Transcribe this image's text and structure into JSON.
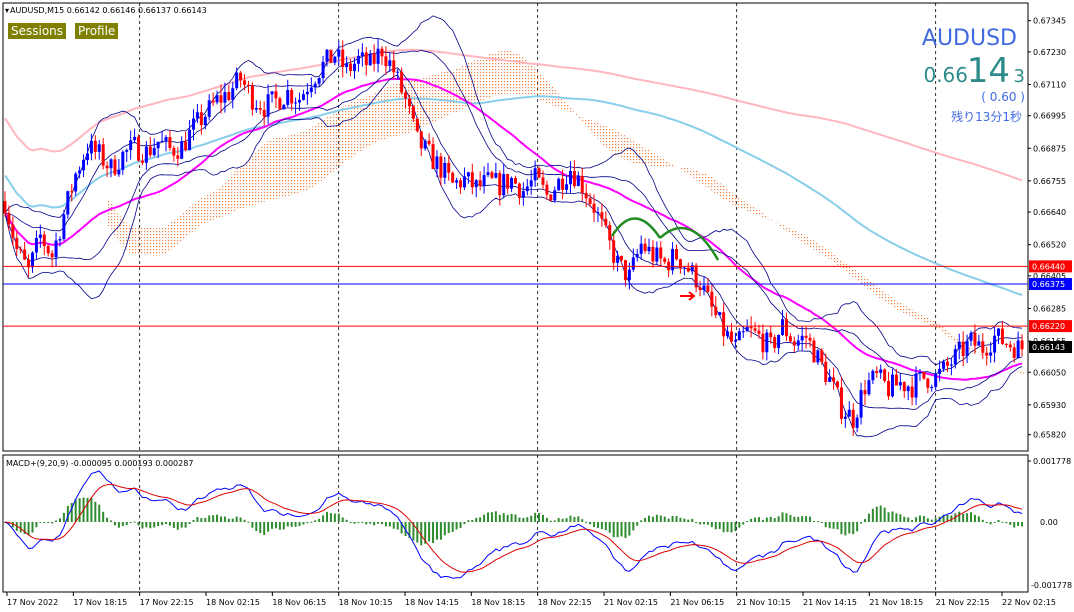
{
  "header": {
    "text": "AUDUSD,M15  0.66142 0.66146 0.66137 0.66143",
    "symbol_big": "AUDUSD"
  },
  "buttons": {
    "sessions": "Sessions",
    "profile": "Profile"
  },
  "price_panel": {
    "prefix": "0.66",
    "big": "14",
    "last": "3",
    "change": "( 0.60 )",
    "remaining": "残り13分1秒"
  },
  "macd": {
    "label": "MACD+(9,20,9) -0.000095 0.000193 0.000287",
    "top_label": "0.001778",
    "zero_label": "0.00",
    "bottom_label": "-0.001778"
  },
  "colors": {
    "up": "#0000ff",
    "down": "#ff0000",
    "ma_fast": "#ff00ff",
    "ma_mid": "#87ceeb",
    "ma_slow": "#ffb6c1",
    "cloud": "#f08040",
    "bollinger": "#00008b",
    "macd_signal": "#dd0000",
    "macd_hist": "#2e8b2e",
    "title": "#4169e1",
    "price": "#2e8b8b",
    "arc": "#228b22"
  },
  "chart_data": {
    "type": "candlestick",
    "symbol": "AUDUSD",
    "timeframe": "M15",
    "ylim": [
      0.6576,
      0.6741
    ],
    "y_ticks": [
      0.67345,
      0.6723,
      0.6711,
      0.66995,
      0.66875,
      0.66755,
      0.6664,
      0.6652,
      0.66405,
      0.66285,
      0.66165,
      0.6605,
      0.6593,
      0.6582
    ],
    "price_labels": [
      {
        "value": 0.6644,
        "text": "0.66440",
        "color": "#ff0000"
      },
      {
        "value": 0.66375,
        "text": "0.66375",
        "color": "#0000ff"
      },
      {
        "value": 0.6622,
        "text": "0.66220",
        "color": "#ff0000"
      },
      {
        "value": 0.66143,
        "text": "0.66143",
        "color": "#000000"
      }
    ],
    "horizontal_lines": [
      {
        "value": 0.6644,
        "color": "#ff0000"
      },
      {
        "value": 0.66375,
        "color": "#0000ff"
      },
      {
        "value": 0.6622,
        "color": "#ff0000"
      }
    ],
    "x_labels": [
      "17 Nov 2022",
      "17 Nov 18:15",
      "17 Nov 22:15",
      "18 Nov 02:15",
      "18 Nov 06:15",
      "18 Nov 10:15",
      "18 Nov 14:15",
      "18 Nov 18:15",
      "18 Nov 22:15",
      "21 Nov 02:15",
      "21 Nov 06:15",
      "21 Nov 10:15",
      "21 Nov 14:15",
      "21 Nov 18:15",
      "21 Nov 22:15",
      "22 Nov 02:15"
    ],
    "session_separators": [
      "17 Nov 22:15",
      "18 Nov 10:15",
      "18 Nov 22:15",
      "21 Nov 10:15",
      "21 Nov 22:15"
    ],
    "price_path": [
      [
        0,
        0.6668
      ],
      [
        3,
        0.665
      ],
      [
        6,
        0.6642
      ],
      [
        9,
        0.6655
      ],
      [
        12,
        0.6648
      ],
      [
        15,
        0.6663
      ],
      [
        18,
        0.6678
      ],
      [
        21,
        0.6688
      ],
      [
        24,
        0.6685
      ],
      [
        27,
        0.668
      ],
      [
        30,
        0.6685
      ],
      [
        33,
        0.6688
      ],
      [
        36,
        0.6686
      ],
      [
        39,
        0.669
      ],
      [
        42,
        0.6687
      ],
      [
        45,
        0.6688
      ],
      [
        48,
        0.6695
      ],
      [
        51,
        0.67
      ],
      [
        54,
        0.6705
      ],
      [
        57,
        0.6708
      ],
      [
        60,
        0.6713
      ],
      [
        63,
        0.6706
      ],
      [
        66,
        0.6703
      ],
      [
        69,
        0.6705
      ],
      [
        72,
        0.6708
      ],
      [
        75,
        0.6706
      ],
      [
        78,
        0.6713
      ],
      [
        81,
        0.6718
      ],
      [
        84,
        0.6722
      ],
      [
        87,
        0.6716
      ],
      [
        90,
        0.672
      ],
      [
        93,
        0.6718
      ],
      [
        96,
        0.6724
      ],
      [
        99,
        0.6716
      ],
      [
        102,
        0.6705
      ],
      [
        105,
        0.669
      ],
      [
        108,
        0.6685
      ],
      [
        111,
        0.668
      ],
      [
        114,
        0.6674
      ],
      [
        117,
        0.6676
      ],
      [
        120,
        0.6673
      ],
      [
        123,
        0.6675
      ],
      [
        126,
        0.6674
      ],
      [
        129,
        0.6676
      ],
      [
        132,
        0.6672
      ],
      [
        135,
        0.6676
      ],
      [
        138,
        0.667
      ],
      [
        141,
        0.6675
      ],
      [
        144,
        0.668
      ],
      [
        147,
        0.6674
      ],
      [
        150,
        0.6666
      ],
      [
        153,
        0.6655
      ],
      [
        156,
        0.6645
      ],
      [
        159,
        0.664
      ],
      [
        162,
        0.6652
      ],
      [
        165,
        0.6648
      ],
      [
        168,
        0.6645
      ],
      [
        171,
        0.6648
      ],
      [
        174,
        0.6643
      ],
      [
        177,
        0.6638
      ],
      [
        180,
        0.6628
      ],
      [
        183,
        0.662
      ],
      [
        186,
        0.6614
      ],
      [
        189,
        0.662
      ],
      [
        192,
        0.6618
      ],
      [
        195,
        0.6614
      ],
      [
        198,
        0.6622
      ],
      [
        201,
        0.6616
      ],
      [
        204,
        0.6618
      ],
      [
        207,
        0.661
      ],
      [
        210,
        0.6602
      ],
      [
        213,
        0.6592
      ],
      [
        216,
        0.6588
      ],
      [
        219,
        0.66
      ],
      [
        222,
        0.6603
      ],
      [
        225,
        0.6599
      ],
      [
        228,
        0.6601
      ],
      [
        231,
        0.66
      ],
      [
        234,
        0.6603
      ],
      [
        237,
        0.6603
      ],
      [
        240,
        0.6607
      ],
      [
        243,
        0.6612
      ],
      [
        246,
        0.6616
      ],
      [
        249,
        0.6614
      ],
      [
        252,
        0.6618
      ],
      [
        255,
        0.6616
      ],
      [
        258,
        0.6614
      ]
    ],
    "annotations": [
      "two green arcs near 21 Nov 02:15–06:15",
      "red arrow near 21 Nov 06:15"
    ]
  }
}
